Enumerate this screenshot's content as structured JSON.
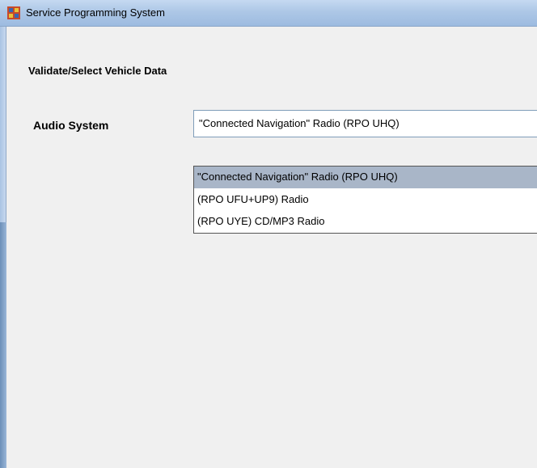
{
  "window": {
    "title": "Service Programming System",
    "icon": "app-icon"
  },
  "form": {
    "section_title": "Validate/Select Vehicle Data",
    "audio_label": "Audio System",
    "audio_value": "\"Connected Navigation\" Radio (RPO UHQ)",
    "options": [
      "\"Connected Navigation\" Radio (RPO UHQ)",
      "(RPO UFU+UP9) Radio",
      "(RPO UYE) CD/MP3 Radio"
    ],
    "selected_index": 0
  },
  "colors": {
    "titlebar": "#adc7e6",
    "background": "#f0f0f0",
    "selected_option": "#a9b6c8"
  }
}
